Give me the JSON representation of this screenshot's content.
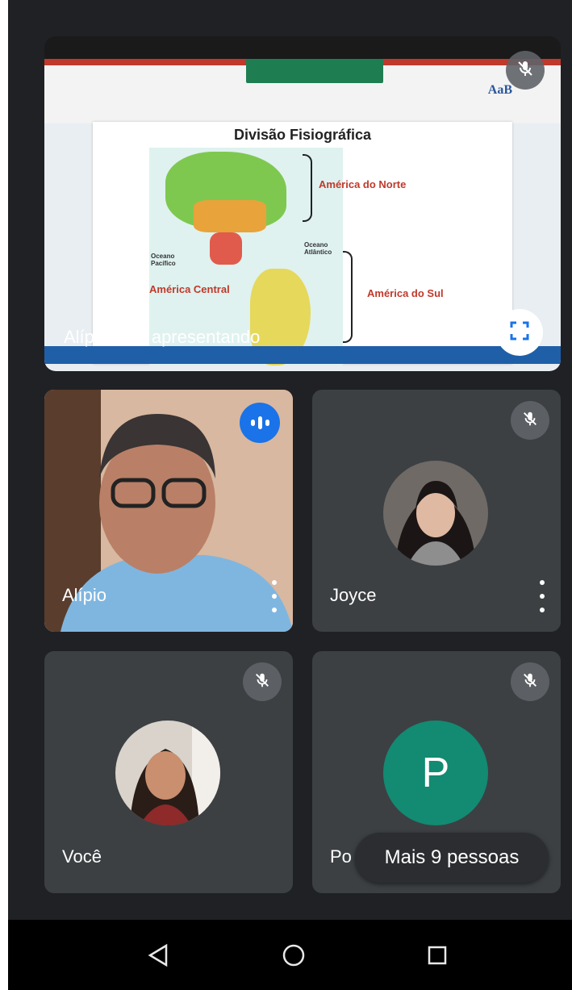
{
  "presentation": {
    "doc_title": "Divisão Fisiográfica",
    "labels": {
      "north": "América do Norte",
      "central": "América Central",
      "south": "América do Sul",
      "pacific": "Oceano Pacífico",
      "atlantic": "Oceano Atlântico"
    },
    "ribbon_style_sample": "AaB",
    "presenting_text": "Alípio está apresentando"
  },
  "participants": [
    {
      "name": "Alípio",
      "state": "speaking"
    },
    {
      "name": "Joyce",
      "state": "muted"
    },
    {
      "name": "Você",
      "state": "muted"
    },
    {
      "name": "Po",
      "initial": "P",
      "state": "muted",
      "avatar_color": "#138a72"
    }
  ],
  "more_people": "Mais 9 pessoas",
  "icons": {
    "mic_off": "mic-off-icon",
    "expand": "fullscreen-icon",
    "speaking": "speaking-indicator-icon",
    "more": "more-vert-icon",
    "nav_back": "triangle-back-icon",
    "nav_home": "circle-home-icon",
    "nav_recent": "square-recents-icon"
  },
  "colors": {
    "background": "#202124",
    "tile": "#3c4043",
    "speaking": "#1a73e8",
    "avatar": "#138a72"
  }
}
